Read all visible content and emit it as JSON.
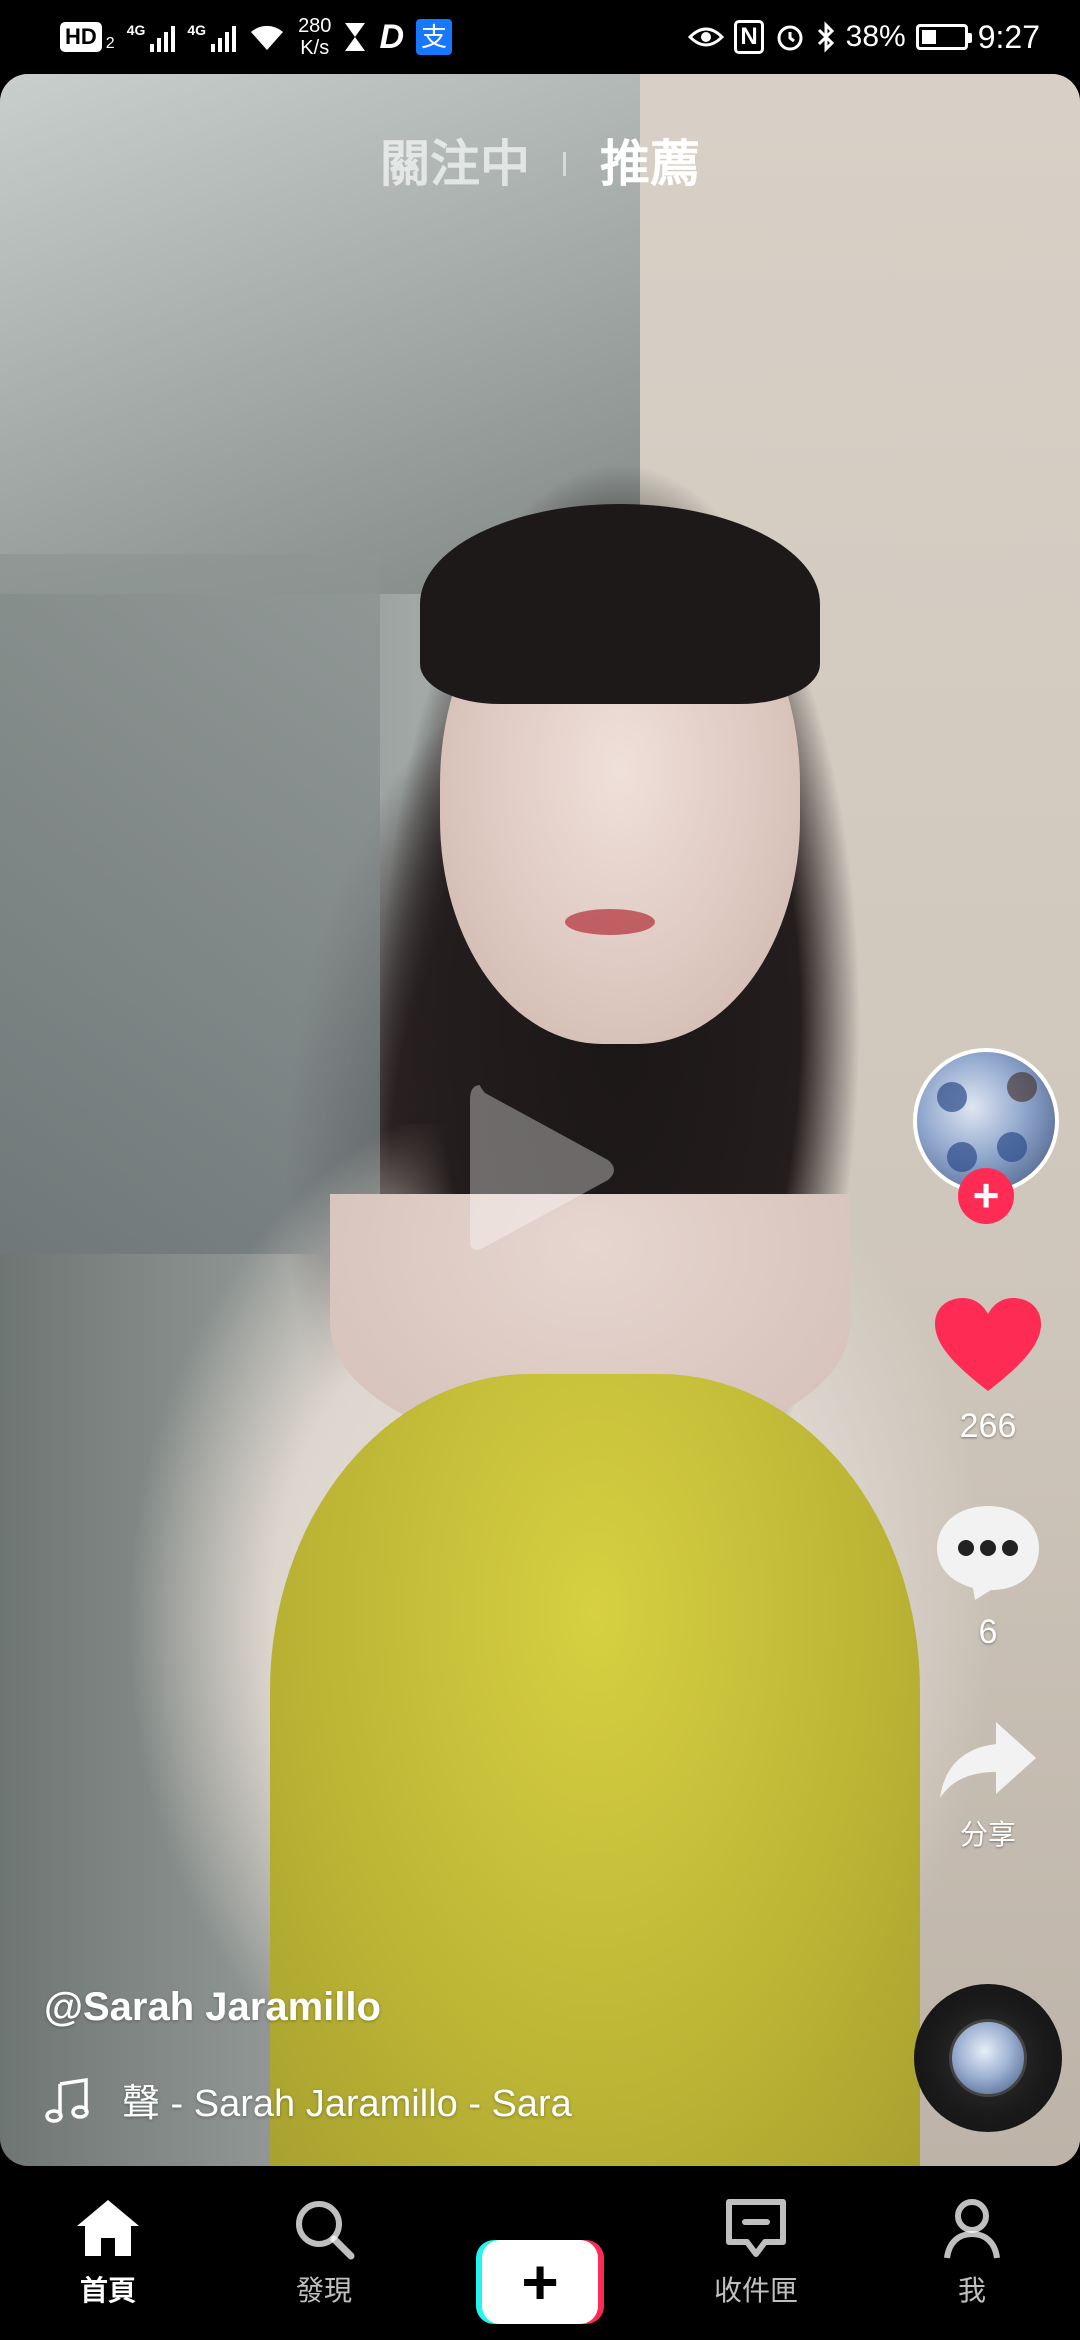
{
  "status_bar": {
    "hd_label": "HD",
    "hd_sub": "2",
    "net1": "4G",
    "net2": "4G",
    "speed_value": "280",
    "speed_unit": "K/s",
    "d_app": "D",
    "alipay_glyph": "支",
    "nfc": "N",
    "battery_percent": "38%",
    "time": "9:27"
  },
  "tabs": [
    {
      "label": "關注中",
      "active": false
    },
    {
      "label": "推薦",
      "active": true
    }
  ],
  "rail": {
    "likes": "266",
    "comments": "6",
    "share_label": "分享"
  },
  "post": {
    "username": "@Sarah Jaramillo",
    "music": "聲 - Sarah Jaramillo - Sara"
  },
  "nav": {
    "home": "首頁",
    "discover": "發現",
    "inbox": "收件匣",
    "me": "我"
  },
  "colors": {
    "accent": "#fe2c55",
    "cyan": "#25f4ee"
  }
}
